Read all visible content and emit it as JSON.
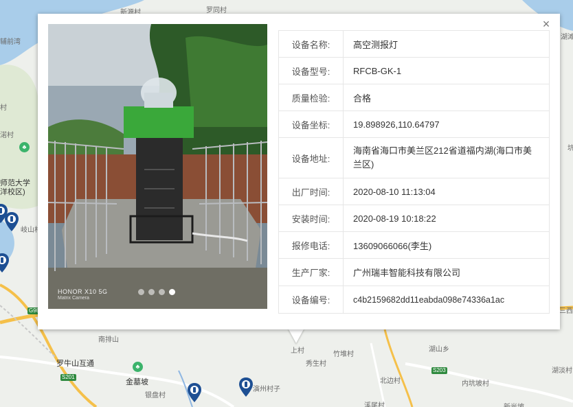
{
  "map": {
    "labels": [
      "新源村",
      "罗同村",
      "辅前湾",
      "村",
      "渃村",
      "师范大学",
      "洋校区)",
      "岐山村",
      "南排山",
      "罗牛山互通",
      "金墓坡",
      "银盘村",
      "演州村子",
      "上村",
      "竹堆村",
      "秀生村",
      "北边村",
      "湖山乡",
      "内坑坡村",
      "湖淡村",
      "溪尾村",
      "新光坡",
      "三西村",
      "坑",
      "湖滩村"
    ],
    "roads": [
      "G98",
      "S201",
      "S203"
    ]
  },
  "popup": {
    "close_label": "×",
    "photo": {
      "watermark_brand": "HONOR X10 5G",
      "watermark_camera": "Matrix Camera",
      "device_caption": "高空测报灯",
      "dots": [
        false,
        false,
        false,
        true
      ]
    },
    "fields": [
      {
        "label": "设备名称:",
        "value": "高空测报灯"
      },
      {
        "label": "设备型号:",
        "value": "RFCB-GK-1"
      },
      {
        "label": "质量检验:",
        "value": "合格"
      },
      {
        "label": "设备坐标:",
        "value": "19.898926,110.64797"
      },
      {
        "label": "设备地址:",
        "value": "海南省海口市美兰区212省道福内湖(海口市美兰区)"
      },
      {
        "label": "出厂时间:",
        "value": "2020-08-10 11:13:04"
      },
      {
        "label": "安装时间:",
        "value": "2020-08-19 10:18:22"
      },
      {
        "label": "报修电话:",
        "value": "13609066066(李生)"
      },
      {
        "label": "生产厂家:",
        "value": "广州瑞丰智能科技有限公司"
      },
      {
        "label": "设备编号:",
        "value": "c4b2159682dd11eabda098e74336a1ac"
      }
    ]
  },
  "colors": {
    "water": "#a9cdea",
    "pin": "#1d4f93",
    "box_green": "#3aa83a"
  }
}
